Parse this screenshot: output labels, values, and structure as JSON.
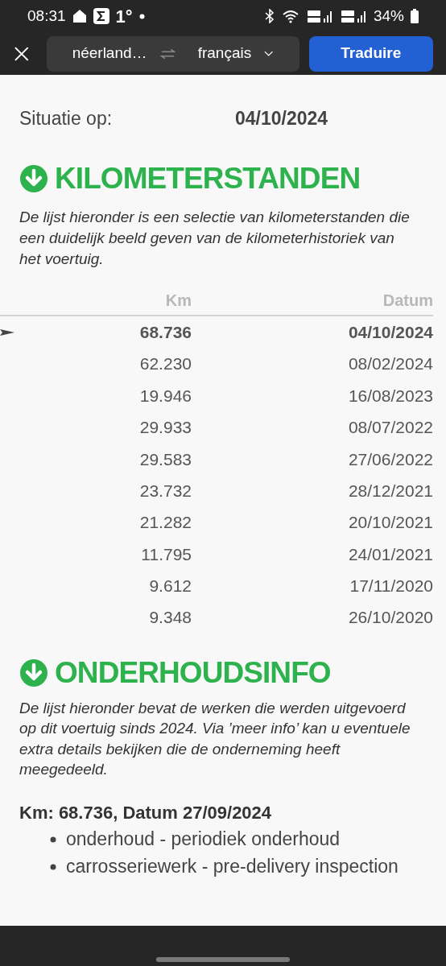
{
  "status_bar": {
    "time": "08:31",
    "temperature": "1°",
    "battery": "34%"
  },
  "toolbar": {
    "source_language": "néerland…",
    "target_language": "français",
    "translate_button": "Traduire"
  },
  "situation": {
    "label": "Situatie op:",
    "value": "04/10/2024"
  },
  "mileage_section": {
    "title": "KILOMETERSTANDEN",
    "description": "De lijst hieronder is een selectie van kilometerstanden die een duidelijk beeld geven van de kilometerhistoriek van het voertuig.",
    "table": {
      "columns": [
        "Km",
        "Datum"
      ],
      "rows": [
        {
          "km": "68.736",
          "date": "04/10/2024",
          "selected": true
        },
        {
          "km": "62.230",
          "date": "08/02/2024",
          "selected": false
        },
        {
          "km": "19.946",
          "date": "16/08/2023",
          "selected": false
        },
        {
          "km": "29.933",
          "date": "08/07/2022",
          "selected": false
        },
        {
          "km": "29.583",
          "date": "27/06/2022",
          "selected": false
        },
        {
          "km": "23.732",
          "date": "28/12/2021",
          "selected": false
        },
        {
          "km": "21.282",
          "date": "20/10/2021",
          "selected": false
        },
        {
          "km": "11.795",
          "date": "24/01/2021",
          "selected": false
        },
        {
          "km": "9.612",
          "date": "17/11/2020",
          "selected": false
        },
        {
          "km": "9.348",
          "date": "26/10/2020",
          "selected": false
        }
      ]
    }
  },
  "maintenance_section": {
    "title": "ONDERHOUDSINFO",
    "description": "De lijst hieronder bevat de werken die werden uitgevoerd op dit voertuig sinds 2024. Via ’meer info’ kan u eventuele extra details bekijken die de onderneming heeft meegedeeld.",
    "entries": [
      {
        "heading": "Km: 68.736, Datum 27/09/2024",
        "items": [
          "onderhoud - periodiek onderhoud",
          "carrosseriewerk - pre-delivery inspection"
        ]
      }
    ]
  }
}
